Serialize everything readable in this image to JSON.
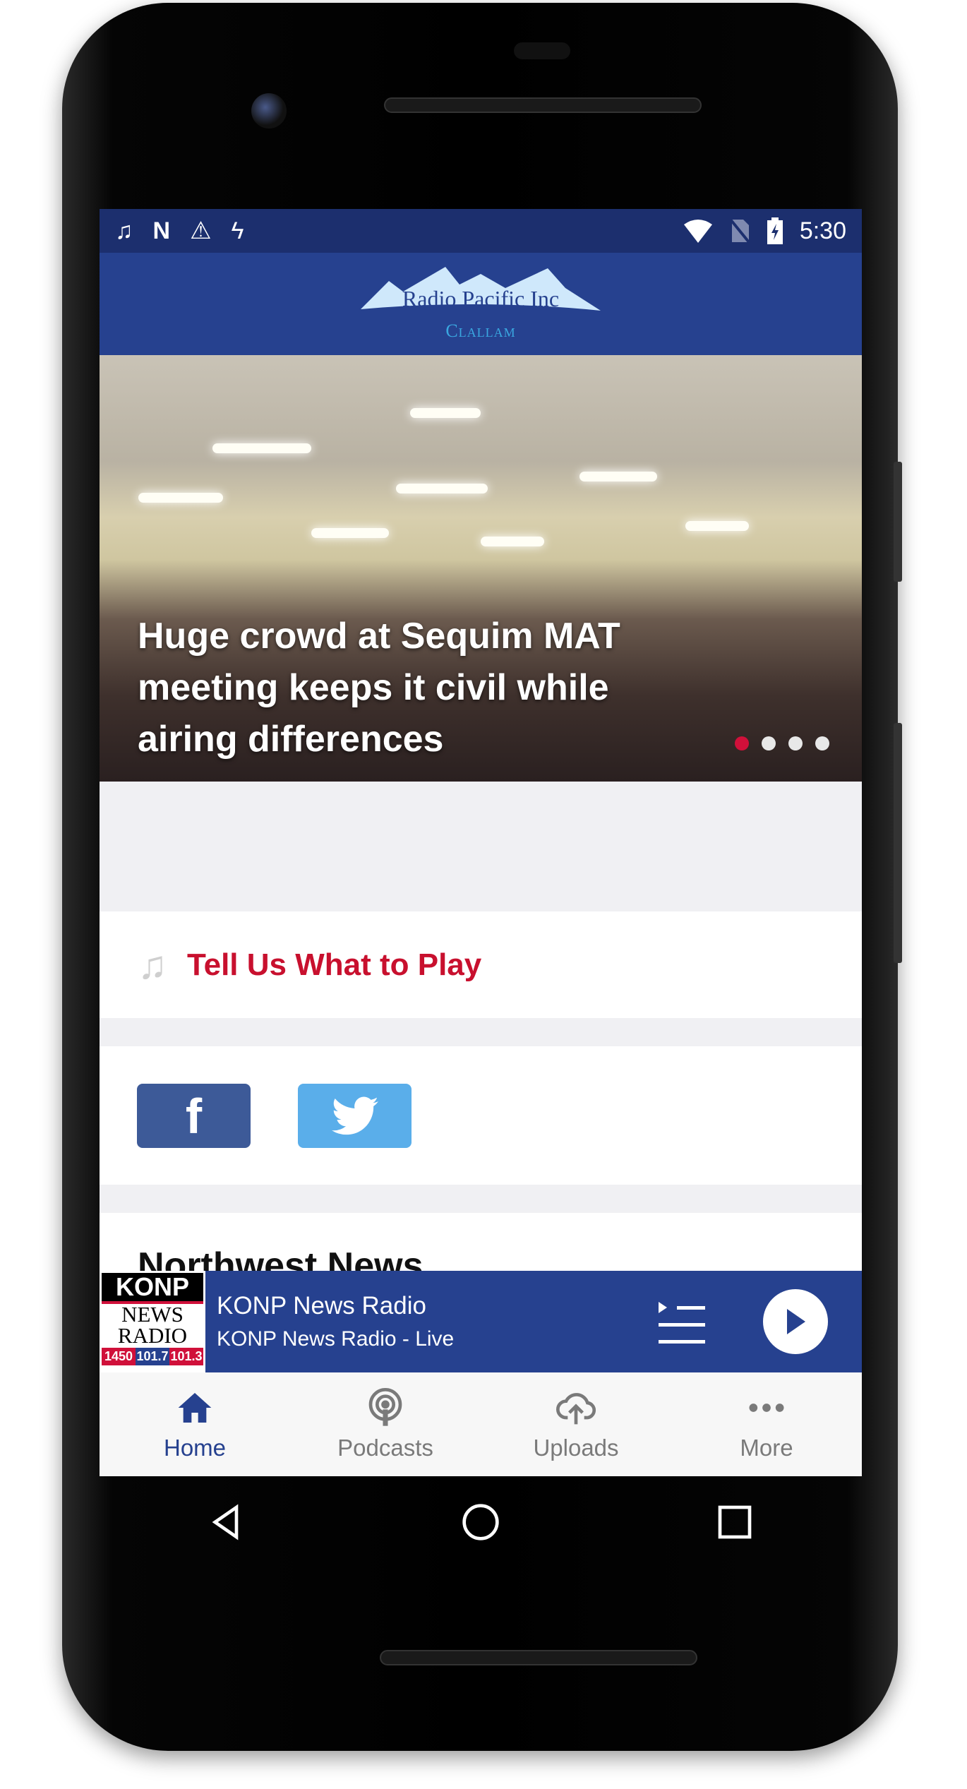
{
  "status_bar": {
    "time": "5:30",
    "left_icons": [
      "music-note-icon",
      "n-icon",
      "construction-icon",
      "flash-icon"
    ],
    "right_icons": [
      "wifi-icon",
      "no-sim-icon",
      "battery-charging-icon"
    ]
  },
  "header": {
    "logo_text": "Radio Pacific Inc",
    "logo_subtitle": "Clallam"
  },
  "hero": {
    "title": "Huge crowd at Sequim MAT meeting keeps it civil while airing differences",
    "slide_count": 4,
    "active_slide": 1,
    "active_dot_color": "#d0103a"
  },
  "tell_us": {
    "label": "Tell Us What to Play",
    "color": "#c8102e"
  },
  "social": {
    "facebook_glyph": "f",
    "facebook_color": "#3d5a98",
    "twitter_color": "#5aaeea"
  },
  "news": {
    "title": "Northwest News"
  },
  "player": {
    "logo": {
      "top": "KONP",
      "mid1": "NEWS",
      "mid2": "RADIO",
      "freqs": [
        "1450",
        "101.7",
        "101.3"
      ]
    },
    "title": "KONP News Radio",
    "subtitle": "KONP News Radio - Live"
  },
  "nav": {
    "items": [
      {
        "label": "Home",
        "icon": "home-icon",
        "active": true
      },
      {
        "label": "Podcasts",
        "icon": "podcast-icon"
      },
      {
        "label": "Uploads",
        "icon": "cloud-upload-icon"
      },
      {
        "label": "More",
        "icon": "more-icon"
      }
    ]
  },
  "colors": {
    "brand": "#26418f",
    "status_bar": "#1c2f6e"
  }
}
